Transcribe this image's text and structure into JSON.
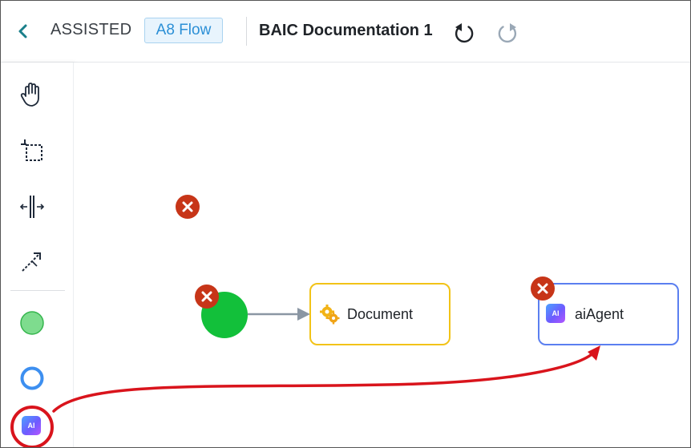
{
  "header": {
    "mode_label": "ASSISTED",
    "flow_badge": "A8 Flow",
    "document_title": "BAIC Documentation 1"
  },
  "toolbar": {
    "tools": [
      "hand-tool",
      "crop-select-tool",
      "space-tool",
      "connect-tool",
      "start-event-tool",
      "end-event-tool",
      "ai-agent-tool"
    ],
    "ai_tool_text": "AI"
  },
  "canvas": {
    "nodes": {
      "document": {
        "label": "Document",
        "border_color": "#f2c318"
      },
      "ai_agent": {
        "label": "aiAgent",
        "icon_text": "AI",
        "border_color": "#5b7ff0"
      }
    },
    "start_event_color": "#12c03a",
    "error_badge_color": "#c73518"
  },
  "annotation": {
    "color": "#d9141c"
  }
}
